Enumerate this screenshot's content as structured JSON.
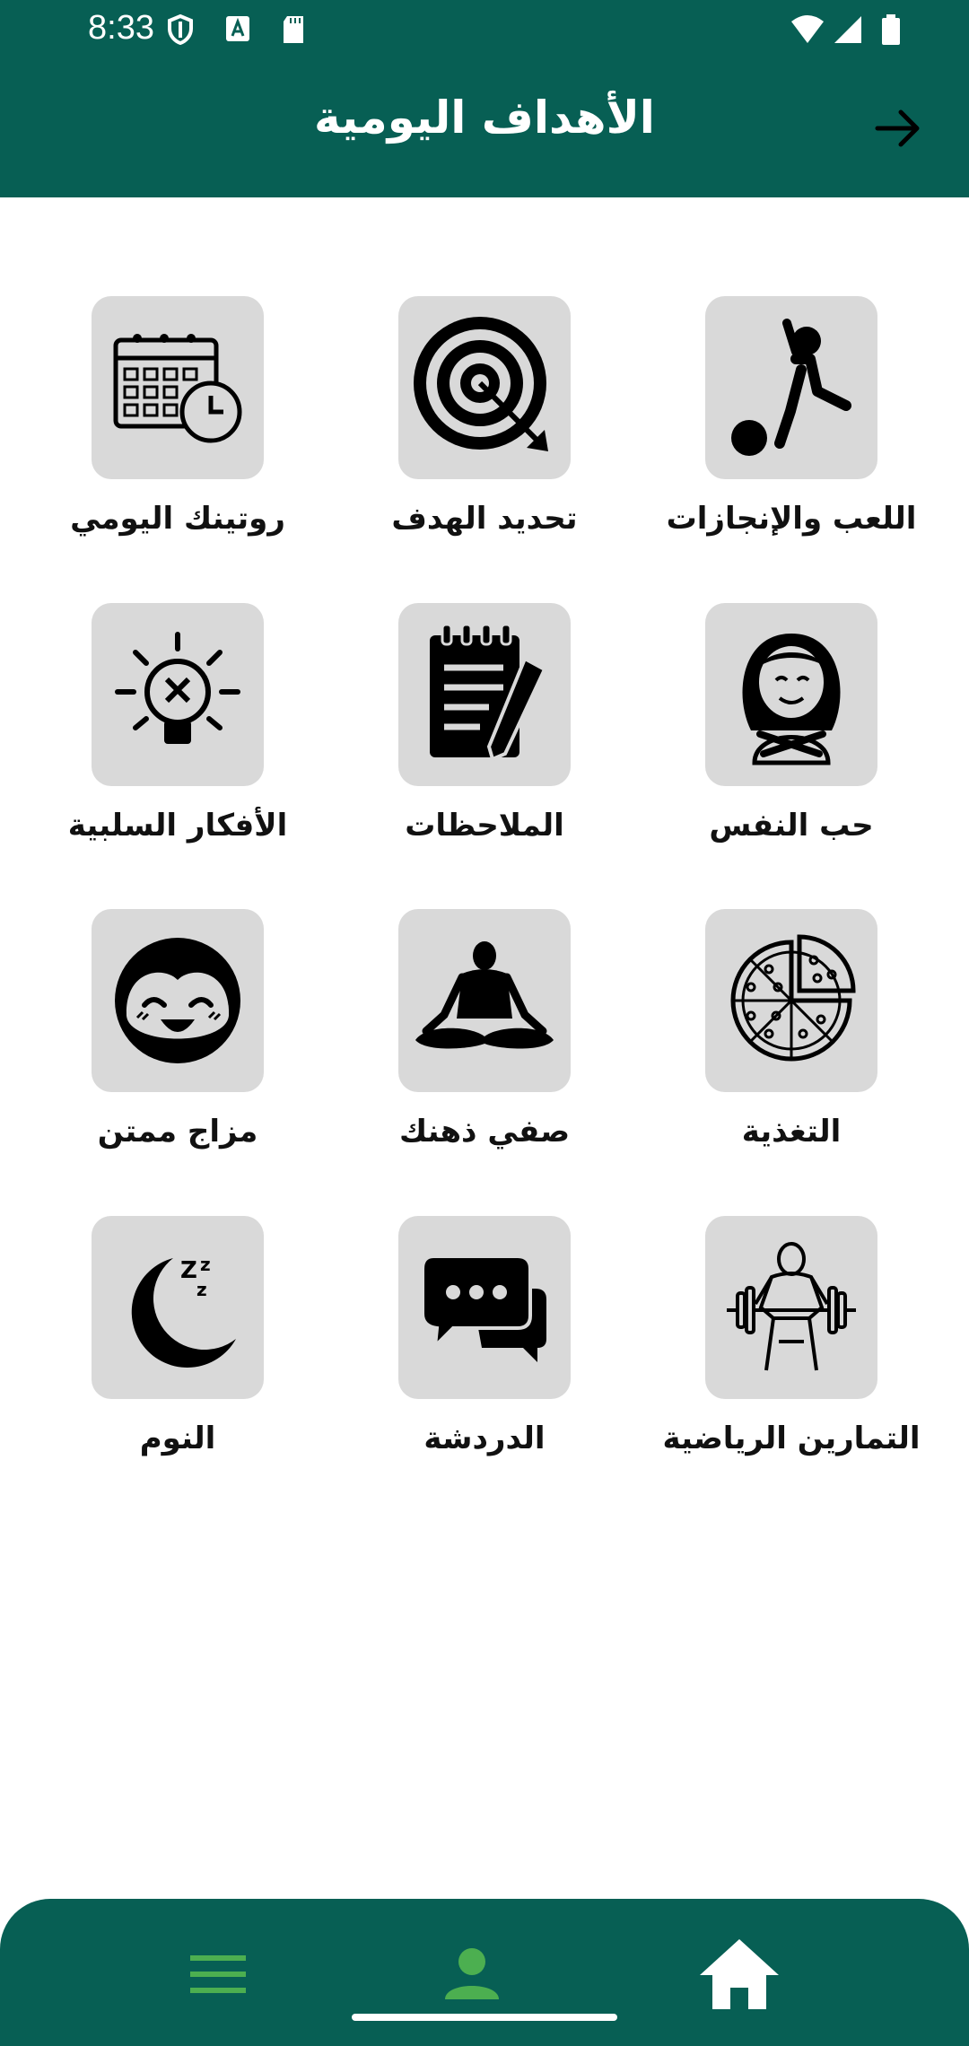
{
  "status_bar": {
    "time": "8:33"
  },
  "header": {
    "title": "الأهداف اليومية"
  },
  "items": [
    {
      "label": "روتينك اليومي",
      "icon": "calendar-clock-icon"
    },
    {
      "label": "تحديد الهدف",
      "icon": "target-icon"
    },
    {
      "label": "اللعب والإنجازات",
      "icon": "player-ball-icon"
    },
    {
      "label": "الأفكار السلبية",
      "icon": "lightbulb-x-icon"
    },
    {
      "label": "الملاحظات",
      "icon": "notepad-pen-icon"
    },
    {
      "label": "حب النفس",
      "icon": "self-hug-icon"
    },
    {
      "label": "مزاج ممتن",
      "icon": "smiling-face-icon"
    },
    {
      "label": "صفي ذهنك",
      "icon": "meditation-icon"
    },
    {
      "label": "التغذية",
      "icon": "pizza-icon"
    },
    {
      "label": "النوم",
      "icon": "moon-sleep-icon"
    },
    {
      "label": "الدردشة",
      "icon": "chat-bubbles-icon"
    },
    {
      "label": "التمارين الرياضية",
      "icon": "weightlifter-icon"
    }
  ],
  "bottom_nav": [
    {
      "icon": "menu-icon"
    },
    {
      "icon": "person-icon"
    },
    {
      "icon": "home-icon"
    }
  ],
  "colors": {
    "primary": "#075f54",
    "tile": "#d9d9d9",
    "accent": "#4caf50"
  }
}
